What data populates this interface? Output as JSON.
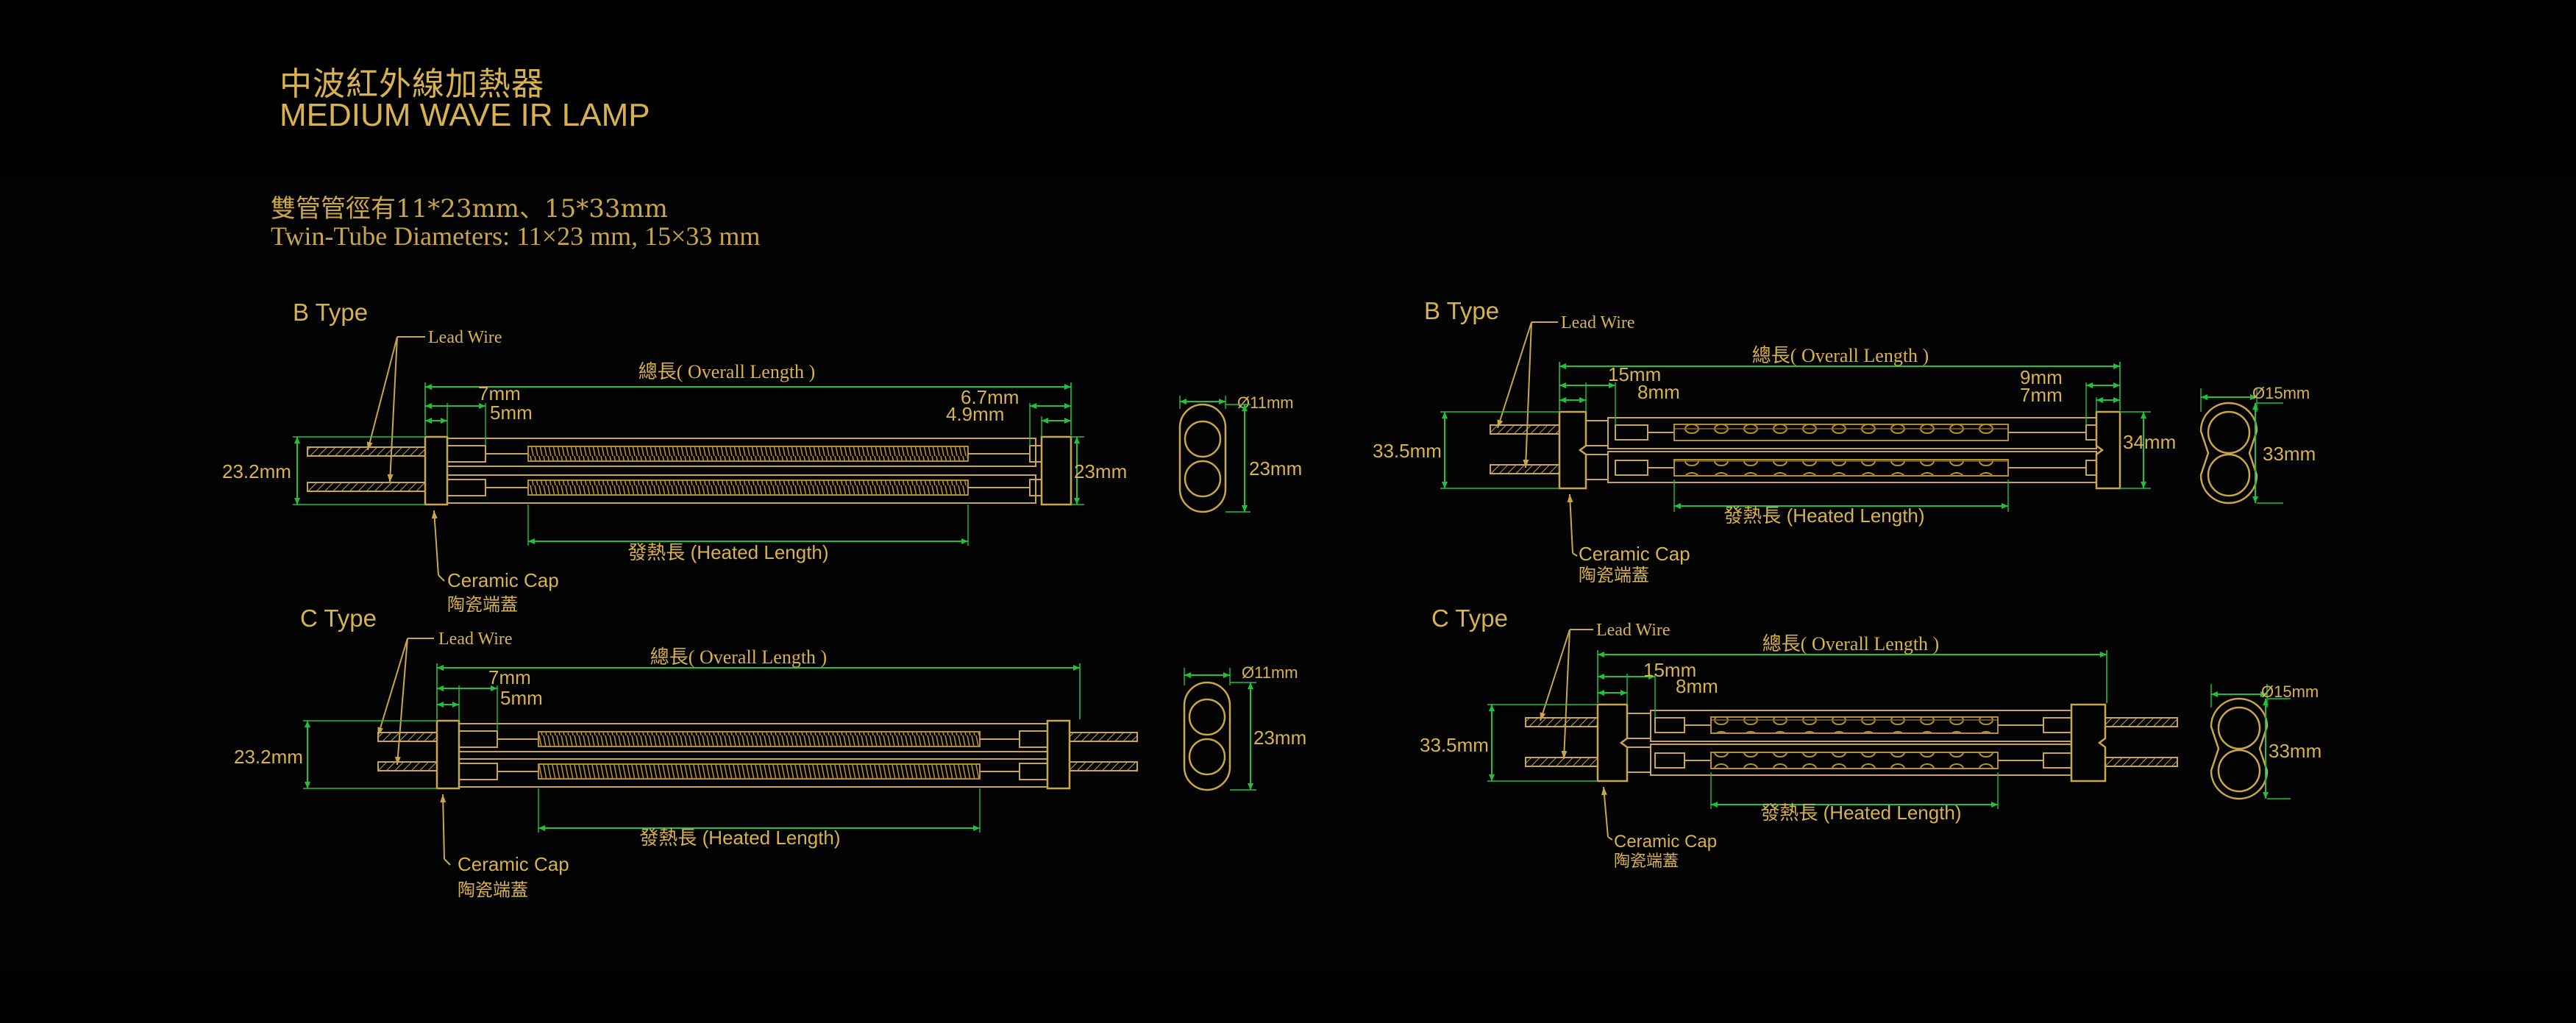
{
  "title": {
    "cn": "中波紅外線加熱器",
    "en": "MEDIUM WAVE IR LAMP"
  },
  "subtitle": {
    "cn": "雙管管徑有11*23mm、15*33mm",
    "en": "Twin-Tube Diameters: 11×23 mm, 15×33 mm"
  },
  "colors": {
    "background": "#000000",
    "panel": "#030303",
    "line_gold": "#c9a64a",
    "text_gold": "#d7b24e",
    "dimension_green": "#1fc23b",
    "filament": "#b58e2e"
  },
  "diagrams": [
    {
      "id": "b-type-11x23",
      "type_label": "B Type",
      "lead_wire": "Lead Wire",
      "overall_length": "總長( Overall Length )",
      "heated_length": "發熱長 (Heated Length)",
      "ceramic_cap_en": "Ceramic Cap",
      "ceramic_cap_cn": "陶瓷端蓋",
      "height": "23.2mm",
      "left_dims": [
        "7mm",
        "5mm"
      ],
      "right_dims": [
        "6.7mm",
        "4.9mm"
      ],
      "end_height": "23mm",
      "section_diameter": "Ø11mm",
      "section_height": "23mm"
    },
    {
      "id": "c-type-11x23",
      "type_label": "C Type",
      "lead_wire": "Lead Wire",
      "overall_length": "總長( Overall Length )",
      "heated_length": "發熱長 (Heated Length)",
      "ceramic_cap_en": "Ceramic Cap",
      "ceramic_cap_cn": "陶瓷端蓋",
      "height": "23.2mm",
      "left_dims": [
        "7mm",
        "5mm"
      ],
      "section_diameter": "Ø11mm",
      "section_height": "23mm"
    },
    {
      "id": "b-type-15x33",
      "type_label": "B Type",
      "lead_wire": "Lead Wire",
      "overall_length": "總長( Overall Length )",
      "heated_length": "發熱長 (Heated Length)",
      "ceramic_cap_en": "Ceramic Cap",
      "ceramic_cap_cn": "陶瓷端蓋",
      "height": "33.5mm",
      "left_dims": [
        "15mm",
        "8mm"
      ],
      "right_dims": [
        "9mm",
        "7mm"
      ],
      "end_height": "34mm",
      "section_diameter": "Ø15mm",
      "section_height": "33mm"
    },
    {
      "id": "c-type-15x33",
      "type_label": "C Type",
      "lead_wire": "Lead Wire",
      "overall_length": "總長( Overall Length )",
      "heated_length": "發熱長 (Heated Length)",
      "ceramic_cap_en": "Ceramic Cap",
      "ceramic_cap_cn": "陶瓷端蓋",
      "height": "33.5mm",
      "left_dims": [
        "15mm",
        "8mm"
      ],
      "section_diameter": "Ø15mm",
      "section_height": "33mm"
    }
  ]
}
